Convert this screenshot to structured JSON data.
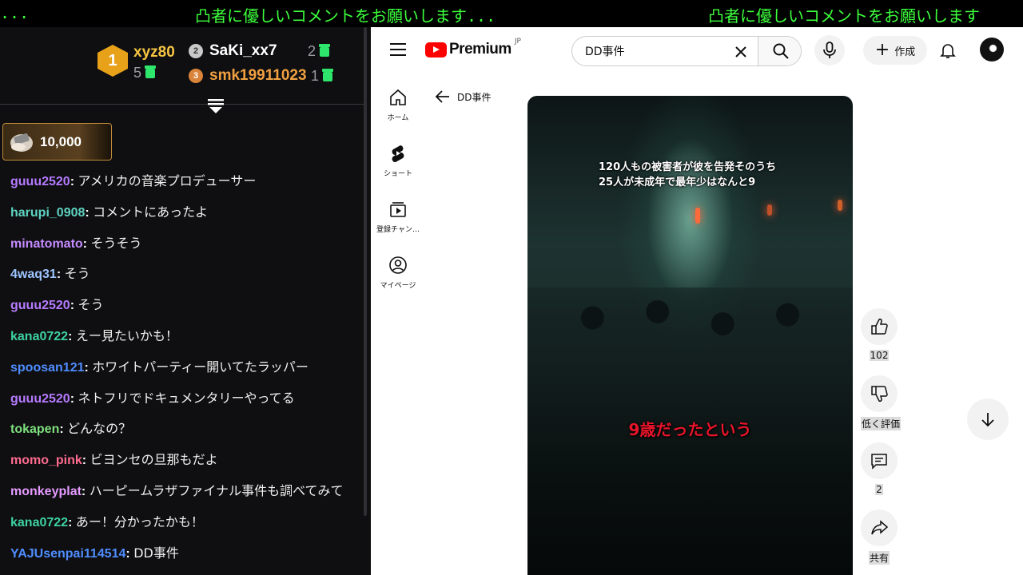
{
  "ticker": {
    "segment_1": "...",
    "segment_2": "凸者に優しいコメントをお願いします...",
    "segment_3": "凸者に優しいコメントをお願いします"
  },
  "chat": {
    "top_supporters": [
      {
        "rank": "1",
        "name": "xyz80",
        "count": "5",
        "name_color": "#f5c542"
      },
      {
        "rank": "2",
        "name": "SaKi_xx7",
        "count": "2",
        "name_color": "#ffffff"
      },
      {
        "rank": "3",
        "name": "smk19911023",
        "count": "1",
        "name_color": "#f0a040"
      }
    ],
    "tip": {
      "amount": "10,000"
    },
    "messages": [
      {
        "user": "guuu2520",
        "color": "#b57bff",
        "text": "アメリカの音楽プロデューサー"
      },
      {
        "user": "harupi_0908",
        "color": "#5ed3c2",
        "text": "コメントにあったよ"
      },
      {
        "user": "minatomato",
        "color": "#c58bff",
        "text": "そうそう"
      },
      {
        "user": "4waq31",
        "color": "#9ec4ff",
        "text": "そう"
      },
      {
        "user": "guuu2520",
        "color": "#b57bff",
        "text": "そう"
      },
      {
        "user": "kana0722",
        "color": "#3ed3a0",
        "text": "えー見たいかも！"
      },
      {
        "user": "spoosan121",
        "color": "#4f8dff",
        "text": "ホワイトパーティー開いてたラッパー"
      },
      {
        "user": "guuu2520",
        "color": "#b57bff",
        "text": "ネトフリでドキュメンタリーやってる"
      },
      {
        "user": "tokapen",
        "color": "#7ee07e",
        "text": "どんなの？"
      },
      {
        "user": "momo_pink",
        "color": "#ff6b8f",
        "text": "ビヨンセの旦那もだよ"
      },
      {
        "user": "monkeyplat",
        "color": "#e59aff",
        "text": "ハーピームラザファイナル事件も調べてみて"
      },
      {
        "user": "kana0722",
        "color": "#3ed3a0",
        "text": "あー！分かったかも！"
      },
      {
        "user": "YAJUsenpai114514",
        "color": "#4f8dff",
        "text": "DD事件"
      }
    ]
  },
  "youtube": {
    "logo_text": "Premium",
    "logo_region": "JP",
    "search_value": "DD事件",
    "create_label": "作成",
    "nav": [
      {
        "label": "ホーム",
        "icon": "home-icon"
      },
      {
        "label": "ショート",
        "icon": "shorts-icon"
      },
      {
        "label": "登録チャン…",
        "icon": "subscriptions-icon"
      },
      {
        "label": "マイページ",
        "icon": "my-page-icon"
      }
    ],
    "back_label": "DD事件",
    "video": {
      "caption_line1": "120人もの被害者が彼を告発そのうち",
      "caption_line2": "25人が未成年で最年少はなんと9",
      "caption_overlay": "9歳だったという"
    },
    "actions": {
      "like_count": "102",
      "dislike_label": "低く評価",
      "comment_count": "2",
      "share_label": "共有"
    }
  }
}
